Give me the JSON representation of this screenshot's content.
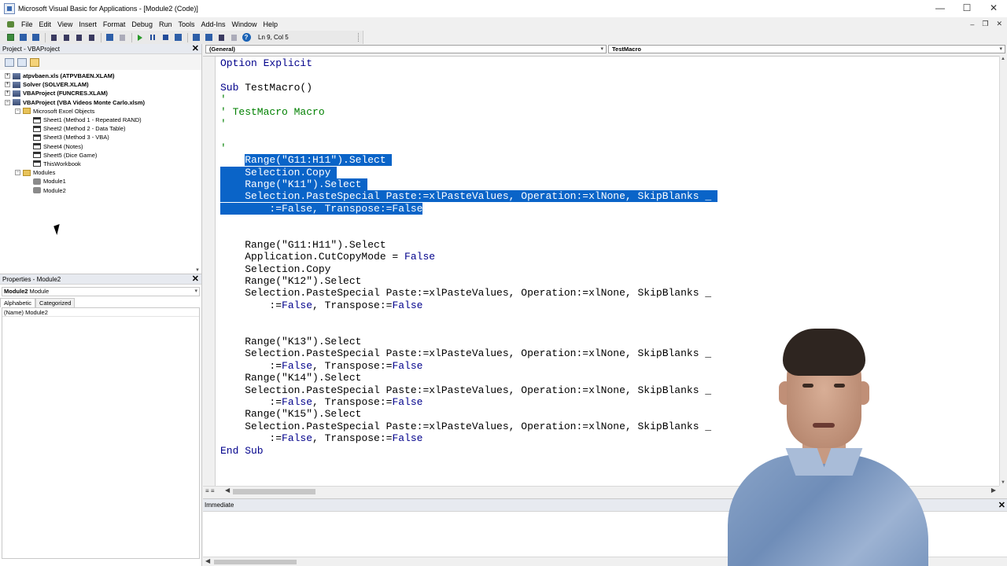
{
  "window": {
    "title": "Microsoft Visual Basic for Applications - [Module2 (Code)]",
    "controls": {
      "minimize": "—",
      "maximize": "☐",
      "close": "✕"
    },
    "mdi_controls": {
      "minimize": "–",
      "restore": "❐",
      "close": "✕"
    }
  },
  "menu": [
    "File",
    "Edit",
    "View",
    "Insert",
    "Format",
    "Debug",
    "Run",
    "Tools",
    "Add-Ins",
    "Window",
    "Help"
  ],
  "toolbar": {
    "position": "Ln 9, Col 5"
  },
  "project": {
    "title": "Project - VBAProject",
    "close": "✕",
    "tree": [
      {
        "label": "atpvbaen.xls (ATPVBAEN.XLAM)",
        "level": 0,
        "toggle": "+",
        "icon": "project-icon",
        "bold": true
      },
      {
        "label": "Solver (SOLVER.XLAM)",
        "level": 0,
        "toggle": "+",
        "icon": "project-icon",
        "bold": true
      },
      {
        "label": "VBAProject (FUNCRES.XLAM)",
        "level": 0,
        "toggle": "+",
        "icon": "project-icon",
        "bold": true
      },
      {
        "label": "VBAProject (VBA Videos Monte Carlo.xlsm)",
        "level": 0,
        "toggle": "−",
        "icon": "project-icon",
        "bold": true
      },
      {
        "label": "Microsoft Excel Objects",
        "level": 1,
        "toggle": "−",
        "icon": "folder-icon",
        "bold": false
      },
      {
        "label": "Sheet1 (Method 1 - Repeated RAND)",
        "level": 2,
        "toggle": "",
        "icon": "sheet-icon",
        "bold": false
      },
      {
        "label": "Sheet2 (Method 2 - Data Table)",
        "level": 2,
        "toggle": "",
        "icon": "sheet-icon",
        "bold": false
      },
      {
        "label": "Sheet3 (Method 3 - VBA)",
        "level": 2,
        "toggle": "",
        "icon": "sheet-icon",
        "bold": false
      },
      {
        "label": "Sheet4 (Notes)",
        "level": 2,
        "toggle": "",
        "icon": "sheet-icon",
        "bold": false
      },
      {
        "label": "Sheet5 (Dice Game)",
        "level": 2,
        "toggle": "",
        "icon": "sheet-icon",
        "bold": false
      },
      {
        "label": "ThisWorkbook",
        "level": 2,
        "toggle": "",
        "icon": "sheet-icon",
        "bold": false
      },
      {
        "label": "Modules",
        "level": 1,
        "toggle": "−",
        "icon": "folder-icon",
        "bold": false
      },
      {
        "label": "Module1",
        "level": 2,
        "toggle": "",
        "icon": "module-icon",
        "bold": false
      },
      {
        "label": "Module2",
        "level": 2,
        "toggle": "",
        "icon": "module-icon",
        "bold": false
      }
    ]
  },
  "properties": {
    "title": "Properties - Module2",
    "close": "✕",
    "object_name": "Module2",
    "object_type": "Module",
    "tabs": [
      "Alphabetic",
      "Categorized"
    ],
    "rows": [
      {
        "name": "(Name)",
        "value": "Module2"
      }
    ]
  },
  "code": {
    "object_combo": "(General)",
    "proc_combo": "TestMacro",
    "lines": [
      [
        {
          "t": "Option Explicit",
          "c": "kw"
        }
      ],
      [],
      [
        {
          "t": "Sub ",
          "c": "kw"
        },
        {
          "t": "TestMacro()",
          "c": ""
        }
      ],
      [
        {
          "t": "'",
          "c": "cm"
        }
      ],
      [
        {
          "t": "' TestMacro Macro",
          "c": "cm"
        }
      ],
      [
        {
          "t": "'",
          "c": "cm"
        }
      ],
      [],
      [
        {
          "t": "'",
          "c": "cm"
        }
      ],
      [
        {
          "t": "    ",
          "c": ""
        },
        {
          "t": "Range(\"G11:H11\").Select ",
          "c": "sel"
        }
      ],
      [
        {
          "t": "    ",
          "c": "sel"
        },
        {
          "t": "Selection.Copy ",
          "c": "sel"
        }
      ],
      [
        {
          "t": "    ",
          "c": "sel"
        },
        {
          "t": "Range(\"K11\").Select ",
          "c": "sel"
        }
      ],
      [
        {
          "t": "    ",
          "c": "sel"
        },
        {
          "t": "Selection.PasteSpecial Paste:=xlPasteValues, Operation:=xlNone, SkipBlanks _ ",
          "c": "sel"
        }
      ],
      [
        {
          "t": "        :=False, Transpose:=False",
          "c": "sel"
        }
      ],
      [],
      [],
      [
        {
          "t": "    Range(\"G11:H11\").Select",
          "c": ""
        }
      ],
      [
        {
          "t": "    Application.CutCopyMode = ",
          "c": ""
        },
        {
          "t": "False",
          "c": "kw"
        }
      ],
      [
        {
          "t": "    Selection.Copy",
          "c": ""
        }
      ],
      [
        {
          "t": "    Range(\"K12\").Select",
          "c": ""
        }
      ],
      [
        {
          "t": "    Selection.PasteSpecial Paste:=xlPasteValues, Operation:=xlNone, SkipBlanks _",
          "c": ""
        }
      ],
      [
        {
          "t": "        :=",
          "c": ""
        },
        {
          "t": "False",
          "c": "kw"
        },
        {
          "t": ", Transpose:=",
          "c": ""
        },
        {
          "t": "False",
          "c": "kw"
        }
      ],
      [],
      [],
      [
        {
          "t": "    Range(\"K13\").Select",
          "c": ""
        }
      ],
      [
        {
          "t": "    Selection.PasteSpecial Paste:=xlPasteValues, Operation:=xlNone, SkipBlanks _",
          "c": ""
        }
      ],
      [
        {
          "t": "        :=",
          "c": ""
        },
        {
          "t": "False",
          "c": "kw"
        },
        {
          "t": ", Transpose:=",
          "c": ""
        },
        {
          "t": "False",
          "c": "kw"
        }
      ],
      [
        {
          "t": "    Range(\"K14\").Select",
          "c": ""
        }
      ],
      [
        {
          "t": "    Selection.PasteSpecial Paste:=xlPasteValues, Operation:=xlNone, SkipBlanks _",
          "c": ""
        }
      ],
      [
        {
          "t": "        :=",
          "c": ""
        },
        {
          "t": "False",
          "c": "kw"
        },
        {
          "t": ", Transpose:=",
          "c": ""
        },
        {
          "t": "False",
          "c": "kw"
        }
      ],
      [
        {
          "t": "    Range(\"K15\").Select",
          "c": ""
        }
      ],
      [
        {
          "t": "    Selection.PasteSpecial Paste:=xlPasteValues, Operation:=xlNone, SkipBlanks _",
          "c": ""
        }
      ],
      [
        {
          "t": "        :=",
          "c": ""
        },
        {
          "t": "False",
          "c": "kw"
        },
        {
          "t": ", Transpose:=",
          "c": ""
        },
        {
          "t": "False",
          "c": "kw"
        }
      ],
      [
        {
          "t": "End Sub",
          "c": "kw"
        }
      ]
    ]
  },
  "immediate": {
    "title": "Immediate",
    "close": "✕"
  },
  "colors": {
    "selection": "#0a64c8",
    "keyword": "#00008b",
    "comment": "#008000"
  }
}
